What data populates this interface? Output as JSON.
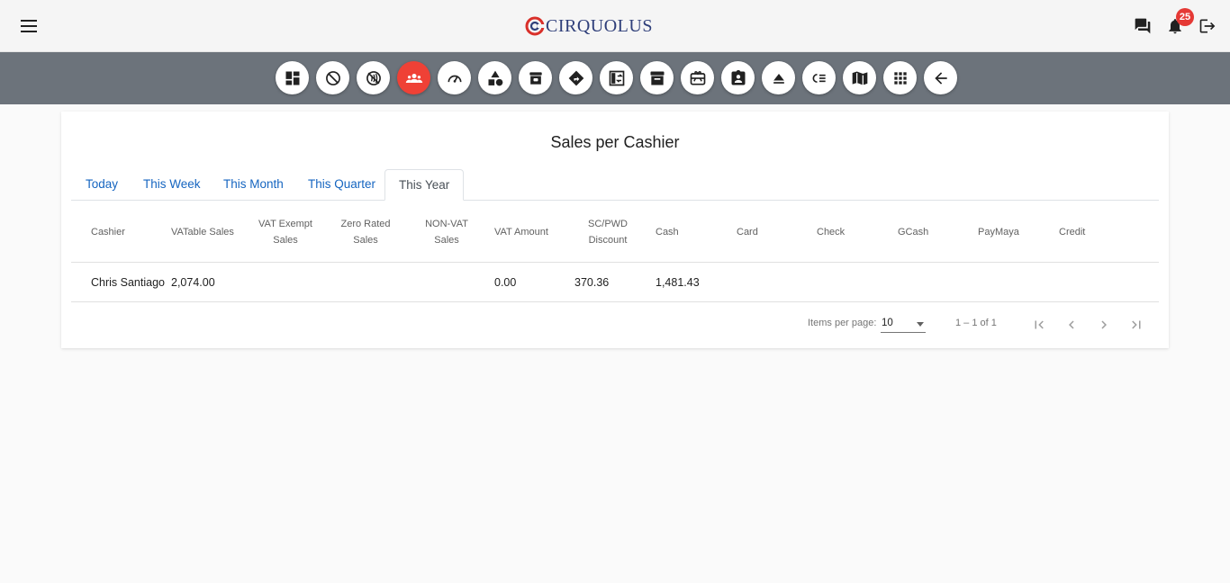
{
  "app": {
    "brand": "CIRQUOLUS",
    "notification_count": "25"
  },
  "icons": {
    "menu": "menu-icon",
    "chat": "chat-icon",
    "bell": "notifications-icon",
    "logout": "logout-icon"
  },
  "toolbar": {
    "items": [
      {
        "icon": "dashboard-icon",
        "active": false
      },
      {
        "icon": "do-not-disturb-icon",
        "active": false
      },
      {
        "icon": "contactless-off-icon",
        "active": false
      },
      {
        "icon": "groups-icon",
        "active": true
      },
      {
        "icon": "speedometer-icon",
        "active": false
      },
      {
        "icon": "category-icon",
        "active": false
      },
      {
        "icon": "archive-box-icon",
        "active": false
      },
      {
        "icon": "directions-icon",
        "active": false
      },
      {
        "icon": "swap-board-icon",
        "active": false
      },
      {
        "icon": "inventory-icon",
        "active": false
      },
      {
        "icon": "gift-card-icon",
        "active": false
      },
      {
        "icon": "assignment-ind-icon",
        "active": false
      },
      {
        "icon": "eject-icon",
        "active": false
      },
      {
        "icon": "checklist-icon",
        "active": false
      },
      {
        "icon": "book-map-icon",
        "active": false
      },
      {
        "icon": "apps-grid-icon",
        "active": false
      },
      {
        "icon": "back-arrow-icon",
        "active": false
      }
    ],
    "accent": "#ef4136",
    "bar_color": "#6c737b"
  },
  "report": {
    "title": "Sales per Cashier",
    "tabs": [
      "Today",
      "This Week",
      "This Month",
      "This Quarter",
      "This Year"
    ],
    "active_tab": "This Year",
    "columns": [
      "Cashier",
      "VATable Sales",
      "VAT Exempt Sales",
      "Zero Rated Sales",
      "NON-VAT Sales",
      "VAT Amount",
      "SC/PWD Discount",
      "Cash",
      "Card",
      "Check",
      "GCash",
      "PayMaya",
      "Credit"
    ],
    "rows": [
      [
        "Chris Santiago",
        "2,074.00",
        "",
        "",
        "",
        "0.00",
        "370.36",
        "1,481.43",
        "",
        "",
        "",
        "",
        ""
      ]
    ]
  },
  "paginator": {
    "items_per_page_label": "Items per page:",
    "items_per_page": "10",
    "range_label": "1 – 1 of 1"
  }
}
